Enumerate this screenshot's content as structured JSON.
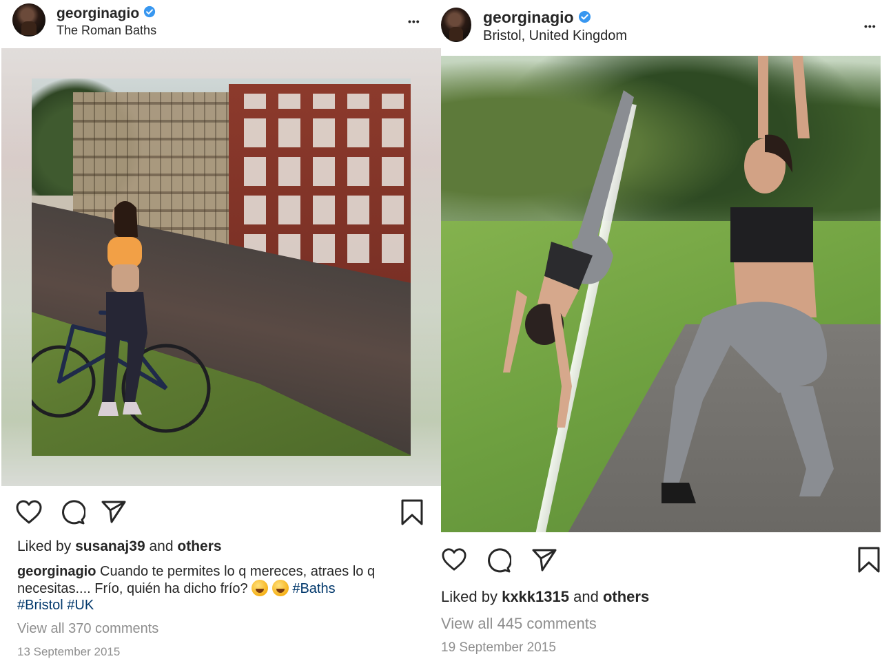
{
  "left_post": {
    "username": "georginagio",
    "location": "The Roman Baths",
    "more_label": "•••",
    "likes": {
      "prefix": "Liked by",
      "user": "susanaj39",
      "middle": "and",
      "others": "others"
    },
    "caption": {
      "user": "georginagio",
      "line1": "Cuando te permites lo q mereces, atraes lo q",
      "line2_text": "necesitas.... Frío, quién ha dicho frío?",
      "hashtag1": "#Baths",
      "hashtag2": "#Bristol",
      "hashtag3": "#UK"
    },
    "comments_label": "View all 370 comments",
    "date": "13 September 2015"
  },
  "right_post": {
    "username": "georginagio",
    "location": "Bristol, United Kingdom",
    "more_label": "•••",
    "likes": {
      "prefix": "Liked by",
      "user": "kxkk1315",
      "middle": "and",
      "others": "others"
    },
    "comments_label": "View all 445 comments",
    "date": "19 September 2015"
  },
  "icons": {
    "like": "heart-icon",
    "comment": "comment-icon",
    "share": "paper-plane-icon",
    "save": "bookmark-icon",
    "verified": "verified-badge-icon"
  },
  "colors": {
    "text": "#262626",
    "muted": "#8e8e8e",
    "hashtag": "#00376b",
    "verified": "#3897f0"
  }
}
